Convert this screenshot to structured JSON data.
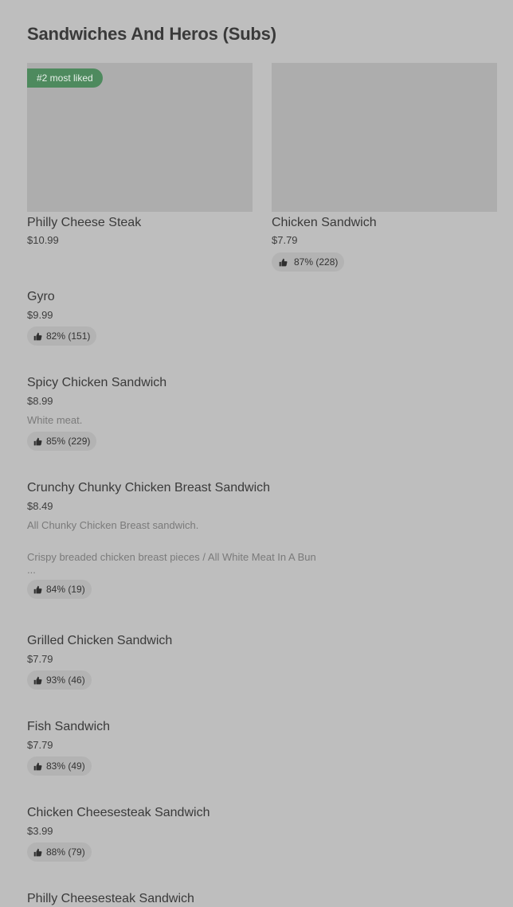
{
  "section": {
    "title": "Sandwiches And Heros (Subs)"
  },
  "featured": [
    {
      "badge": "#2 most liked",
      "name": "Philly Cheese Steak",
      "price": "$10.99"
    },
    {
      "name": "Chicken Sandwich",
      "price": "$7.79",
      "rating": "87% (228)"
    }
  ],
  "items": [
    {
      "name": "Gyro",
      "price": "$9.99",
      "rating": "82% (151)"
    },
    {
      "name": "Spicy Chicken Sandwich",
      "price": "$8.99",
      "description": "White meat.",
      "rating": "85% (229)"
    },
    {
      "name": "Crunchy Chunky Chicken Breast Sandwich",
      "price": "$8.49",
      "description": "All Chunky Chicken Breast sandwich.",
      "description2": "Crispy breaded chicken breast pieces / All White Meat In A Bun",
      "ellipsis": "...",
      "rating": "84% (19)"
    },
    {
      "name": "Grilled Chicken Sandwich",
      "price": "$7.79",
      "rating": "93% (46)"
    },
    {
      "name": "Fish Sandwich",
      "price": "$7.79",
      "rating": "83% (49)"
    },
    {
      "name": "Chicken Cheesesteak Sandwich",
      "price": "$3.99",
      "rating": "88% (79)"
    },
    {
      "name": "Philly Cheesesteak Sandwich"
    }
  ],
  "icons": {
    "rating": "thumbs-up-icon"
  },
  "colors": {
    "background": "#bebebe",
    "badge": "#4e8a5e",
    "image_placeholder": "#adadad",
    "rating_pill": "#b3b3b3"
  }
}
